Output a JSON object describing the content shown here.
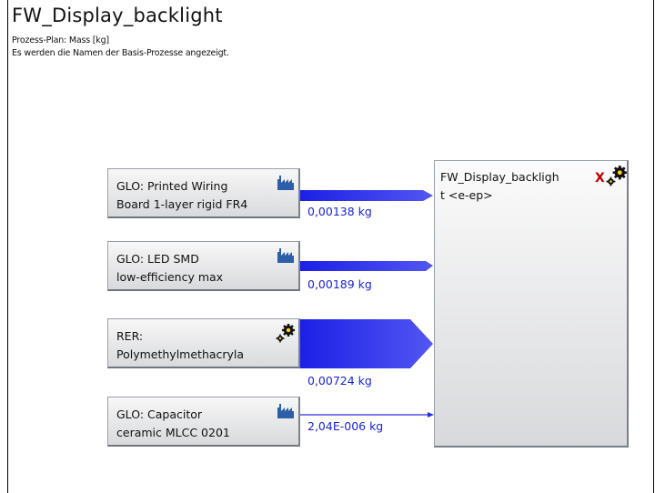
{
  "diagram": {
    "title": "FW_Display_backlight",
    "subtitle1": "Prozess-Plan: Mass [kg]",
    "subtitle2": "Es werden die Namen der Basis-Prozesse angezeigt."
  },
  "processes": [
    {
      "line1": "GLO: Printed Wiring",
      "line2": "Board 1-layer rigid FR4",
      "icon": "factory-icon",
      "amount": "0,00138 kg"
    },
    {
      "line1": "GLO: LED SMD",
      "line2": "low-efficiency max",
      "icon": "factory-icon",
      "amount": "0,00189 kg"
    },
    {
      "line1": "RER:",
      "line2": "Polymethylmethacryla",
      "icon": "gear-icon",
      "amount": "0,00724 kg"
    },
    {
      "line1": "GLO: Capacitor",
      "line2": "ceramic MLCC 0201",
      "icon": "factory-icon",
      "amount": "2,04E-006 kg"
    }
  ],
  "target": {
    "line1": "FW_Display_backligh",
    "line2": "t <e-ep>",
    "close_mark": "X",
    "icon": "gear-icon"
  },
  "colors": {
    "flow": "#1f23e8",
    "amount_text": "#1a23d6",
    "close": "#c00000"
  }
}
